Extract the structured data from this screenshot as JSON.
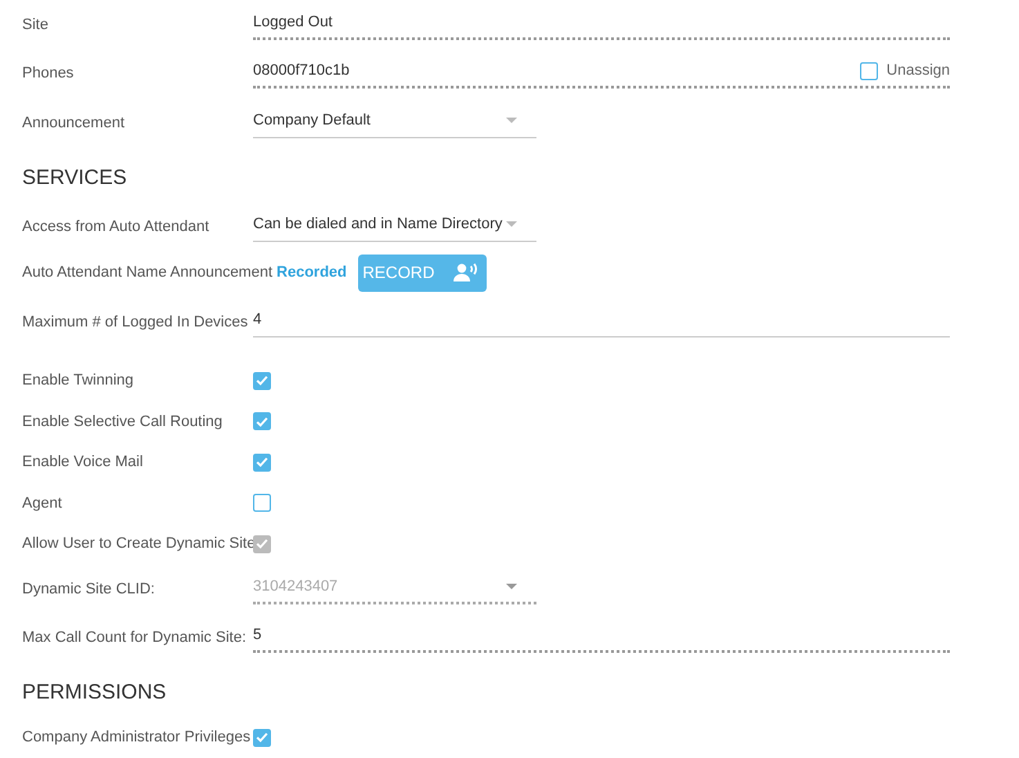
{
  "fields": [
    {
      "kind": "text",
      "label": "Site",
      "value": "Logged Out"
    },
    {
      "kind": "text",
      "label": "Phones",
      "value": "08000f710c1b",
      "option": {
        "label": "Unassign",
        "checked": false
      }
    },
    {
      "kind": "select",
      "label": "Announcement",
      "value": "Company Default",
      "disabled": false
    }
  ],
  "services": {
    "title": "SERVICES",
    "fields": [
      {
        "kind": "select",
        "label": "Access from Auto Attendant",
        "value": "Can be dialed and in Name Directory",
        "disabled": false
      },
      {
        "kind": "record",
        "label": "Auto Attendant Name Announcement",
        "status": "Recorded",
        "button": "RECORD"
      },
      {
        "kind": "input",
        "label": "Maximum # of Logged In Devices",
        "value": "4"
      },
      {
        "kind": "checkbox",
        "label": "Enable Twinning",
        "checked": true,
        "disabled": false
      },
      {
        "kind": "checkbox",
        "label": "Enable Selective Call Routing",
        "checked": true,
        "disabled": false
      },
      {
        "kind": "checkbox",
        "label": "Enable Voice Mail",
        "checked": true,
        "disabled": false
      },
      {
        "kind": "checkbox",
        "label": "Agent",
        "checked": false,
        "disabled": false
      },
      {
        "kind": "checkbox",
        "label": "Allow User to Create Dynamic Site",
        "checked": true,
        "disabled": true
      },
      {
        "kind": "select",
        "label": "Dynamic Site CLID:",
        "value": "3104243407",
        "disabled": true
      },
      {
        "kind": "text",
        "label": "Max Call Count for Dynamic Site:",
        "value": "5"
      }
    ]
  },
  "permissions": {
    "title": "PERMISSIONS",
    "fields": [
      {
        "kind": "checkbox",
        "label": "Company Administrator Privileges",
        "checked": true,
        "disabled": false
      }
    ]
  }
}
